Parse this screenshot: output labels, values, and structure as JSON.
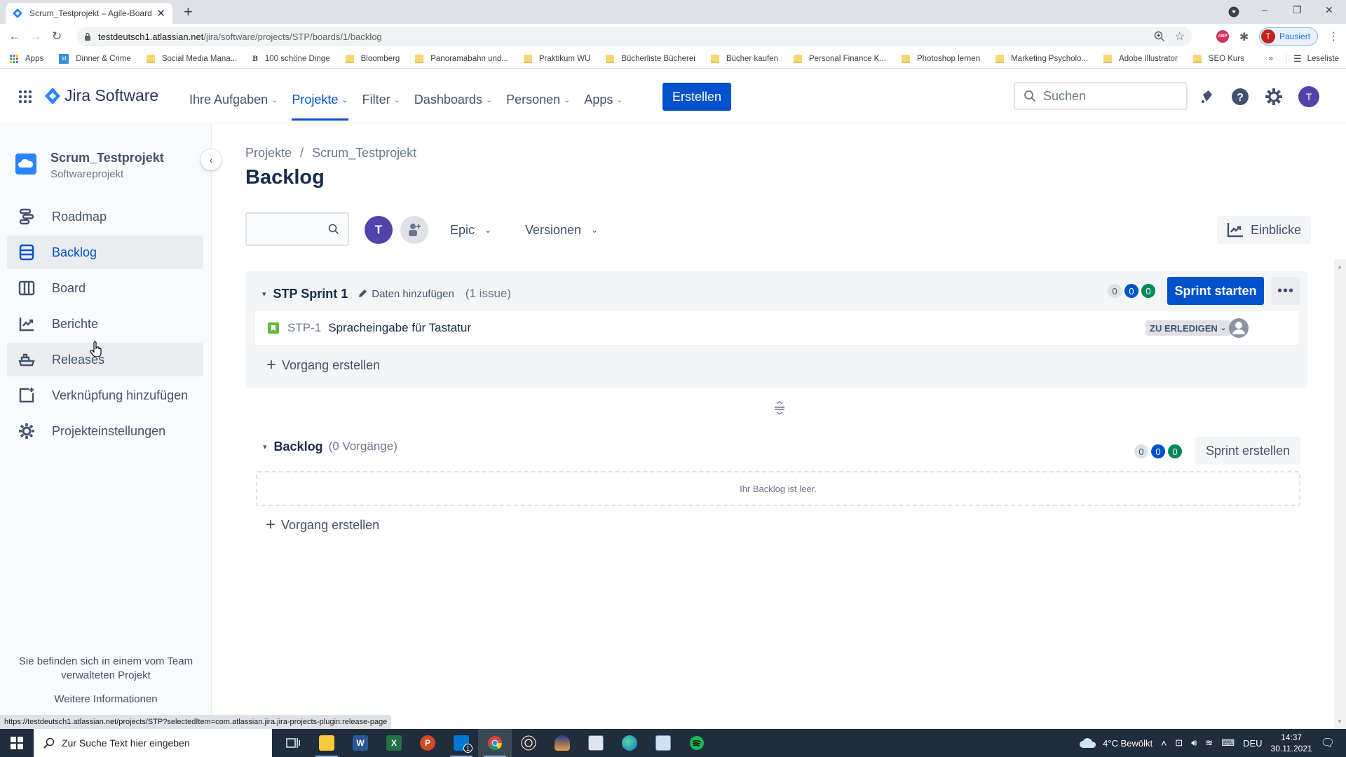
{
  "browser": {
    "tab_title": "Scrum_Testprojekt – Agile-Board",
    "url_host": "testdeutsch1.atlassian.net",
    "url_path": "/jira/software/projects/STP/boards/1/backlog",
    "profile_label": "Pausiert",
    "profile_initial": "T",
    "extension_label": "ABP",
    "bookmarks": [
      {
        "label": "Apps",
        "icon": "apps-grid-icon"
      },
      {
        "label": "Dinner & Crime",
        "icon": "site-icon"
      },
      {
        "label": "Social Media Mana...",
        "icon": "folder-icon"
      },
      {
        "label": "100 schöne Dinge",
        "icon": "site-icon"
      },
      {
        "label": "Bloomberg",
        "icon": "folder-icon"
      },
      {
        "label": "Panoramabahn und...",
        "icon": "folder-icon"
      },
      {
        "label": "Praktikum WU",
        "icon": "folder-icon"
      },
      {
        "label": "Bücherliste Bücherei",
        "icon": "folder-icon"
      },
      {
        "label": "Bücher kaufen",
        "icon": "folder-icon"
      },
      {
        "label": "Personal Finance K...",
        "icon": "folder-icon"
      },
      {
        "label": "Photoshop lernen",
        "icon": "folder-icon"
      },
      {
        "label": "Marketing Psycholo...",
        "icon": "folder-icon"
      },
      {
        "label": "Adobe Illustrator",
        "icon": "folder-icon"
      },
      {
        "label": "SEO Kurs",
        "icon": "folder-icon"
      }
    ],
    "bookmarks_overflow": "»",
    "reading_list": "Leseliste",
    "status_url": "https://testdeutsch1.atlassian.net/projects/STP?selectedItem=com.atlassian.jira.jira-projects-plugin:release-page"
  },
  "topnav": {
    "product": "Jira Software",
    "items": [
      {
        "label": "Ihre Aufgaben",
        "active": false
      },
      {
        "label": "Projekte",
        "active": true
      },
      {
        "label": "Filter",
        "active": false
      },
      {
        "label": "Dashboards",
        "active": false
      },
      {
        "label": "Personen",
        "active": false
      },
      {
        "label": "Apps",
        "active": false
      }
    ],
    "create_label": "Erstellen",
    "search_placeholder": "Suchen",
    "avatar_initial": "T"
  },
  "sidebar": {
    "project_name": "Scrum_Testprojekt",
    "project_type": "Softwareprojekt",
    "items": [
      {
        "label": "Roadmap",
        "icon": "roadmap-icon"
      },
      {
        "label": "Backlog",
        "icon": "backlog-icon"
      },
      {
        "label": "Board",
        "icon": "board-icon"
      },
      {
        "label": "Berichte",
        "icon": "reports-icon"
      },
      {
        "label": "Releases",
        "icon": "releases-icon"
      },
      {
        "label": "Verknüpfung hinzufügen",
        "icon": "add-shortcut-icon"
      },
      {
        "label": "Projekteinstellungen",
        "icon": "settings-icon"
      }
    ],
    "footer_text": "Sie befinden sich in einem vom Team verwalteten Projekt",
    "footer_link": "Weitere Informationen"
  },
  "main": {
    "breadcrumb": [
      "Projekte",
      "Scrum_Testprojekt"
    ],
    "breadcrumb_sep": "/",
    "title": "Backlog",
    "filter_avatar": "T",
    "filters": [
      "Epic",
      "Versionen"
    ],
    "insights_label": "Einblicke",
    "sprint": {
      "name": "STP Sprint 1",
      "edit_label": "Daten hinzufügen",
      "issue_count": "(1 issue)",
      "counts": {
        "todo": "0",
        "in_progress": "0",
        "done": "0"
      },
      "start_label": "Sprint starten",
      "more_label": "•••",
      "issues": [
        {
          "key": "STP-1",
          "summary": "Spracheingabe für Tastatur",
          "status": "ZU ERLEDIGEN",
          "type": "story"
        }
      ],
      "create_label": "Vorgang erstellen"
    },
    "backlog": {
      "name": "Backlog",
      "issue_count": "(0 Vorgänge)",
      "counts": {
        "todo": "0",
        "in_progress": "0",
        "done": "0"
      },
      "create_sprint_label": "Sprint erstellen",
      "empty_text": "Ihr Backlog ist leer.",
      "create_label": "Vorgang erstellen"
    }
  },
  "taskbar": {
    "search_placeholder": "Zur Suche Text hier eingeben",
    "mail_badge": "1",
    "weather": "4°C  Bewölkt",
    "language": "DEU",
    "time": "14:37",
    "date": "30.11.2021"
  },
  "colors": {
    "brand_blue": "#0052cc",
    "done_green": "#00875a",
    "avatar_purple": "#5243aa",
    "story_green": "#63ba3c"
  }
}
